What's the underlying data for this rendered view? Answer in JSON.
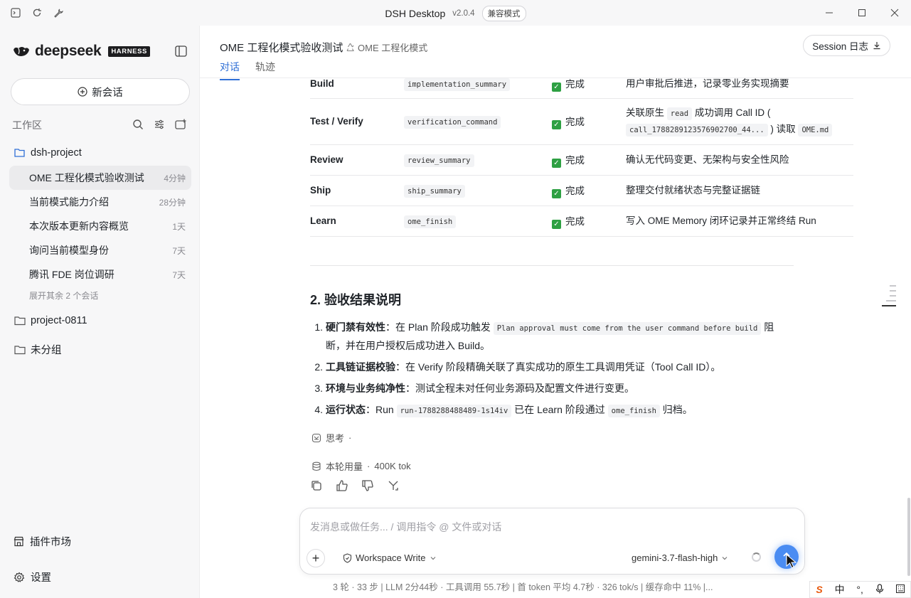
{
  "window": {
    "title": "DSH Desktop",
    "version": "v2.0.4",
    "compat_badge": "兼容模式"
  },
  "sidebar": {
    "logo_text": "deepseek",
    "logo_badge": "HARNESS",
    "new_chat_label": "新会话",
    "workspace_label": "工作区",
    "projects": [
      {
        "name": "dsh-project"
      },
      {
        "name": "project-0811"
      },
      {
        "name": "未分组"
      }
    ],
    "conversations": [
      {
        "title": "OME 工程化模式验收测试",
        "time": "4分钟"
      },
      {
        "title": "当前模式能力介绍",
        "time": "28分钟"
      },
      {
        "title": "本次版本更新内容概览",
        "time": "1天"
      },
      {
        "title": "询问当前模型身份",
        "time": "7天"
      },
      {
        "title": "腾讯 FDE 岗位调研",
        "time": "7天"
      }
    ],
    "expand_more": "展开其余 2 个会话",
    "plugin_market": "插件市场",
    "settings": "设置"
  },
  "header": {
    "title": "OME 工程化模式验收测试",
    "mode_tag": "OME 工程化模式",
    "session_log": "Session 日志",
    "tabs": [
      {
        "label": "对话"
      },
      {
        "label": "轨迹"
      }
    ]
  },
  "table": {
    "status_label": "完成",
    "rows": [
      {
        "stage": "Build",
        "artifact": "implementation_summary",
        "note": "用户审批后推进，记录零业务实现摘要"
      },
      {
        "stage": "Test / Verify",
        "artifact": "verification_command",
        "note_prefix": "关联原生",
        "note_code1": "read",
        "note_mid": "成功调用 Call ID (",
        "note_code2": "call_1788289123576902700_44...",
        "note_mid2": ") 读取",
        "note_code3": "OME.md"
      },
      {
        "stage": "Review",
        "artifact": "review_summary",
        "note": "确认无代码变更、无架构与安全性风险"
      },
      {
        "stage": "Ship",
        "artifact": "ship_summary",
        "note": "整理交付就绪状态与完整证据链"
      },
      {
        "stage": "Learn",
        "artifact": "ome_finish",
        "note": "写入 OME Memory 闭环记录并正常终结 Run"
      }
    ]
  },
  "section": {
    "title": "2. 验收结果说明",
    "items": [
      {
        "num": "1.",
        "bold": "硬门禁有效性",
        "text1": "：在 Plan 阶段成功触发 ",
        "code": "Plan approval must come from the user command before build",
        "text2": " 阻断，并在用户授权后成功进入 Build。"
      },
      {
        "num": "2.",
        "bold": "工具链证据校验",
        "text1": "：在 Verify 阶段精确关联了真实成功的原生工具调用凭证（Tool Call ID）。"
      },
      {
        "num": "3.",
        "bold": "环境与业务纯净性",
        "text1": "：测试全程未对任何业务源码及配置文件进行变更。"
      },
      {
        "num": "4.",
        "bold": "运行状态",
        "text1": "：Run ",
        "code": "run-1788288488489-1s14iv",
        "text2": " 已在 Learn 阶段通过 ",
        "code2": "ome_finish",
        "text3": " 归档。"
      }
    ]
  },
  "meta": {
    "think_label": "思考",
    "think_dot": "·",
    "usage_label": "本轮用量",
    "usage_value": "400K tok"
  },
  "composer": {
    "placeholder": "发消息或做任务... / 调用指令 @ 文件或对话",
    "permission": "Workspace Write",
    "model": "gemini-3.7-flash-high"
  },
  "stats": "3 轮 · 33 步   |   LLM 2分44秒 · 工具调用 55.7秒   |   首 token 平均 4.7秒 · 326 tok/s   |   缓存命中 11%   |...",
  "ime": {
    "s": "S",
    "zh": "中",
    "punct": "°,"
  },
  "colors": {
    "accent": "#2f6fd6",
    "success": "#2ea043",
    "send": "#4a8cf2"
  }
}
